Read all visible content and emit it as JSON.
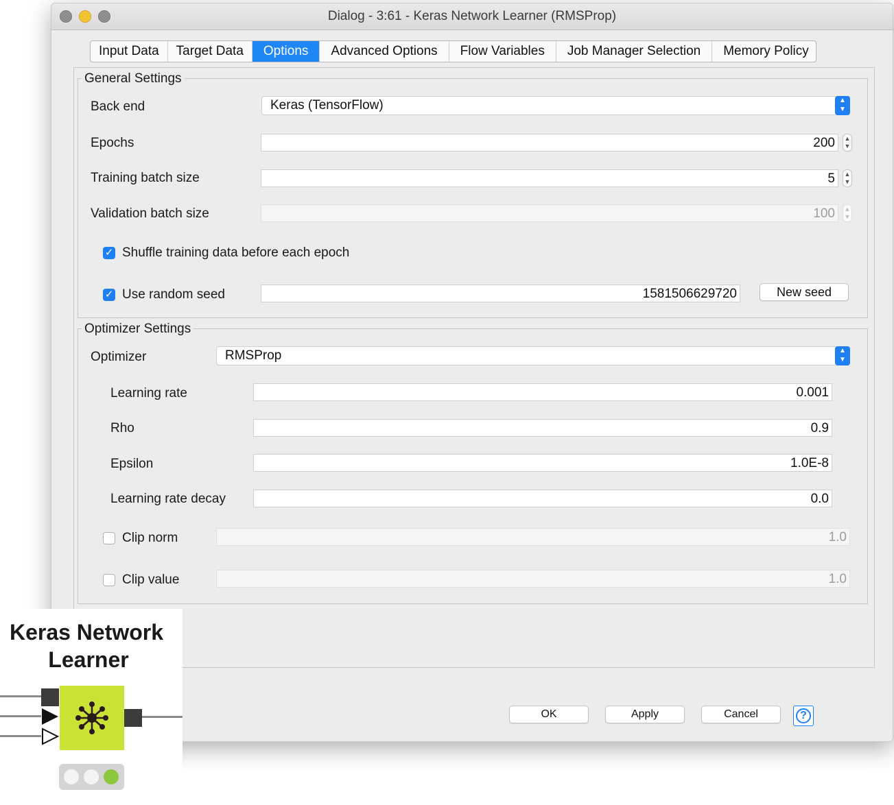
{
  "window": {
    "title": "Dialog - 3:61 - Keras Network Learner (RMSProp)",
    "traffic_lights": [
      "close",
      "minimize",
      "zoom"
    ]
  },
  "tabs": [
    {
      "label": "Input Data",
      "active": false
    },
    {
      "label": "Target Data",
      "active": false
    },
    {
      "label": "Options",
      "active": true
    },
    {
      "label": "Advanced Options",
      "active": false
    },
    {
      "label": "Flow Variables",
      "active": false
    },
    {
      "label": "Job Manager Selection",
      "active": false
    },
    {
      "label": "Memory Policy",
      "active": false
    }
  ],
  "general": {
    "legend": "General Settings",
    "backend": {
      "label": "Back end",
      "value": "Keras (TensorFlow)"
    },
    "epochs": {
      "label": "Epochs",
      "value": "200"
    },
    "train_batch": {
      "label": "Training batch size",
      "value": "5"
    },
    "val_batch": {
      "label": "Validation batch size",
      "value": "100"
    },
    "shuffle": {
      "label": "Shuffle training data before each epoch",
      "checked": true
    },
    "seed": {
      "label": "Use random seed",
      "checked": true,
      "value": "1581506629720",
      "button": "New seed"
    }
  },
  "optimizer": {
    "legend": "Optimizer Settings",
    "optimizer": {
      "label": "Optimizer",
      "value": "RMSProp"
    },
    "learning_rate": {
      "label": "Learning rate",
      "value": "0.001"
    },
    "rho": {
      "label": "Rho",
      "value": "0.9"
    },
    "epsilon": {
      "label": "Epsilon",
      "value": "1.0E-8"
    },
    "lr_decay": {
      "label": "Learning rate decay",
      "value": "0.0"
    },
    "clip_norm": {
      "label": "Clip norm",
      "checked": false,
      "value": "1.0"
    },
    "clip_value": {
      "label": "Clip value",
      "checked": false,
      "value": "1.0"
    }
  },
  "buttons": {
    "ok": "OK",
    "apply": "Apply",
    "cancel": "Cancel",
    "help": "?"
  },
  "node": {
    "title_line1": "Keras Network",
    "title_line2": "Learner",
    "color": "#c9e235",
    "icon": "neural-network-icon",
    "status": "executed"
  },
  "colors": {
    "accent": "#1f87f5",
    "node": "#c9e235",
    "status_green": "#8dc63f"
  }
}
